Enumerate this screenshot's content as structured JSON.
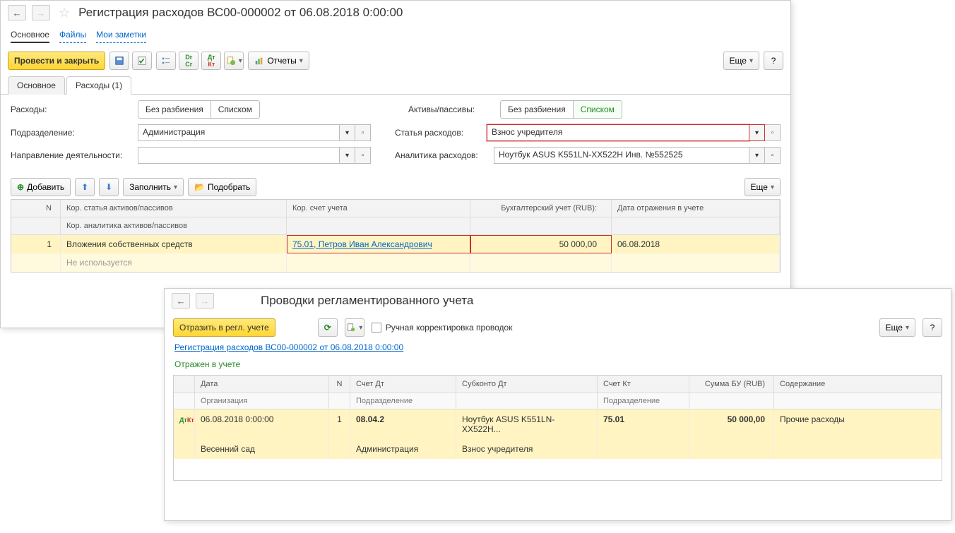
{
  "win1": {
    "title": "Регистрация расходов ВС00-000002 от 06.08.2018 0:00:00",
    "navTabs": {
      "main": "Основное",
      "files": "Файлы",
      "notes": "Мои заметки"
    },
    "toolbar": {
      "postAndClose": "Провести и закрыть",
      "reports": "Отчеты",
      "more": "Еще",
      "help": "?"
    },
    "contentTabs": {
      "main": "Основное",
      "expenses": "Расходы (1)"
    },
    "labels": {
      "expenses": "Расходы:",
      "assets": "Активы/пассивы:",
      "department": "Подразделение:",
      "expenseItem": "Статья расходов:",
      "direction": "Направление деятельности:",
      "analytics": "Аналитика расходов:"
    },
    "toggles": {
      "noSplit": "Без разбиения",
      "asList": "Списком"
    },
    "fields": {
      "department": "Администрация",
      "expenseItem": "Взнос учредителя",
      "direction": "",
      "analytics": "Ноутбук ASUS K551LN-XX522H Инв. №552525"
    },
    "tableToolbar": {
      "add": "Добавить",
      "fill": "Заполнить",
      "pick": "Подобрать",
      "more": "Еще"
    },
    "gridHeaders": {
      "n": "N",
      "article": "Кор. статья активов/пассивов",
      "articleSub": "Кор. аналитика активов/пассивов",
      "account": "Кор. счет учета",
      "amount": "Бухгалтерский учет (RUB):",
      "date": "Дата отражения в учете"
    },
    "gridRow": {
      "n": "1",
      "article": "Вложения собственных средств",
      "articleSub": "Не используется",
      "account": "75.01, Петров Иван Александрович",
      "amount": "50 000,00",
      "date": "06.08.2018"
    }
  },
  "win2": {
    "title": "Проводки регламентированного учета",
    "toolbar": {
      "reflect": "Отразить в регл. учете",
      "manual": "Ручная корректировка проводок",
      "more": "Еще",
      "help": "?"
    },
    "docLink": "Регистрация расходов ВС00-000002 от 06.08.2018 0:00:00",
    "status": "Отражен в учете",
    "headers": {
      "date": "Дата",
      "n": "N",
      "accDt": "Счет Дт",
      "subDt": "Субконто Дт",
      "accKt": "Счет Кт",
      "sum": "Сумма БУ (RUB)",
      "desc": "Содержание",
      "org": "Организация",
      "dept": "Подразделение",
      "dept2": "Подразделение"
    },
    "row": {
      "date": "06.08.2018 0:00:00",
      "n": "1",
      "accDt": "08.04.2",
      "subDt": "Ноутбук ASUS K551LN-XX522H...",
      "accKt": "75.01",
      "sum": "50 000,00",
      "desc": "Прочие расходы",
      "org": "Весенний сад",
      "dept": "Администрация",
      "subDt2": "Взнос учредителя"
    }
  }
}
